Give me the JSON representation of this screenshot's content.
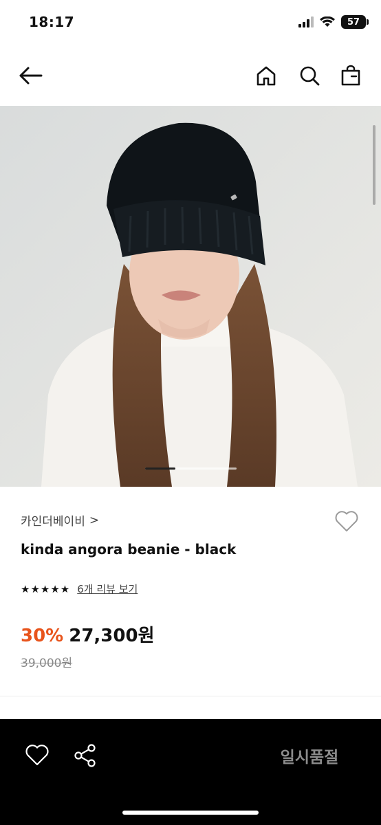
{
  "status_bar": {
    "time": "18:17",
    "battery": "57"
  },
  "nav": {
    "back_icon": "arrow-left-icon",
    "home_icon": "home-icon",
    "search_icon": "search-icon",
    "bag_icon": "shopping-bag-icon"
  },
  "gallery": {
    "current_index_fraction": 0.33
  },
  "product": {
    "brand": "카인더베이비",
    "brand_chevron": ">",
    "title": "kinda angora beanie - black",
    "stars": "★★★★★",
    "rating": 5,
    "review_link": "6개 리뷰 보기",
    "discount": "30%",
    "price": "27,300원",
    "original_price": "39,000원"
  },
  "bottom_bar": {
    "wish_icon": "heart-outline-icon",
    "share_icon": "share-icon",
    "sold_out_label": "일시품절"
  },
  "colors": {
    "discount": "#e8541c",
    "bottom_bar_bg": "#000000",
    "sold_out_text": "#8c8c8c"
  }
}
